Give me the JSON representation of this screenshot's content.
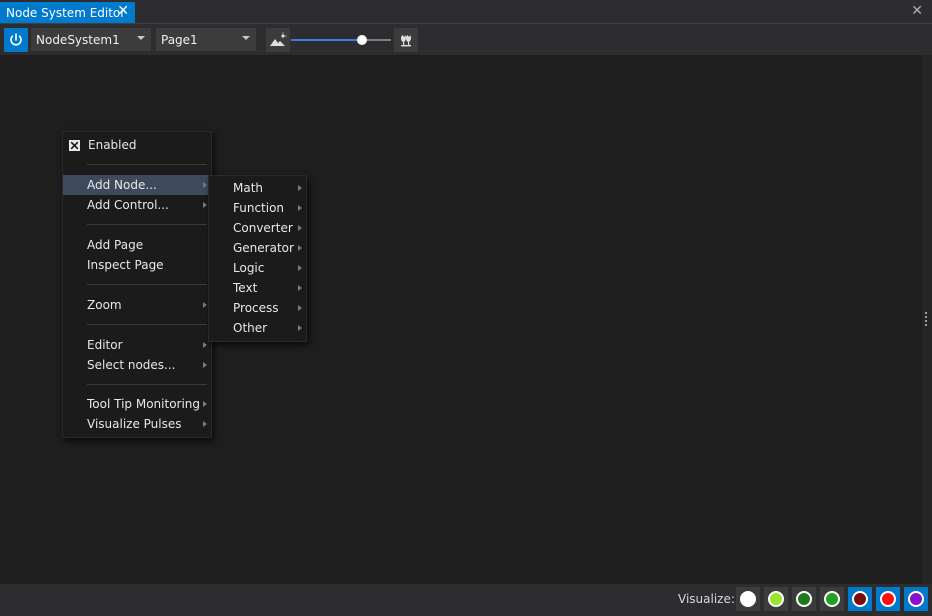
{
  "tab": {
    "title": "Node System Editor",
    "close_glyph": "✕"
  },
  "window": {
    "close_glyph": "✕"
  },
  "toolbar": {
    "power_icon": "power-icon",
    "system_select": "NodeSystem1",
    "page_select": "Page1",
    "background_icon": "image-brightness-icon",
    "zoom_level": 0.71,
    "overlay_icon": "flowers-icon"
  },
  "context_menu": {
    "enabled_label": "Enabled",
    "enabled_checked": true,
    "add_node": "Add Node...",
    "add_control": "Add Control...",
    "add_page": "Add Page",
    "inspect_page": "Inspect Page",
    "zoom": "Zoom",
    "editor": "Editor",
    "select_nodes": "Select nodes...",
    "tooltip_monitoring": "Tool Tip Monitoring",
    "visualize_pulses": "Visualize Pulses"
  },
  "submenu": {
    "items": [
      "Math",
      "Function",
      "Converter",
      "Generator",
      "Logic",
      "Text",
      "Process",
      "Other"
    ]
  },
  "status": {
    "visualize_label": "Visualize:",
    "buttons": [
      {
        "color": "#ffffff",
        "active": false
      },
      {
        "color": "#9ae62a",
        "active": false
      },
      {
        "color": "#1e7a1e",
        "active": false
      },
      {
        "color": "#22a022",
        "active": false
      },
      {
        "color": "#7a0c0c",
        "active": true
      },
      {
        "color": "#ff1010",
        "active": true
      },
      {
        "color": "#8a10d0",
        "active": true
      }
    ]
  }
}
